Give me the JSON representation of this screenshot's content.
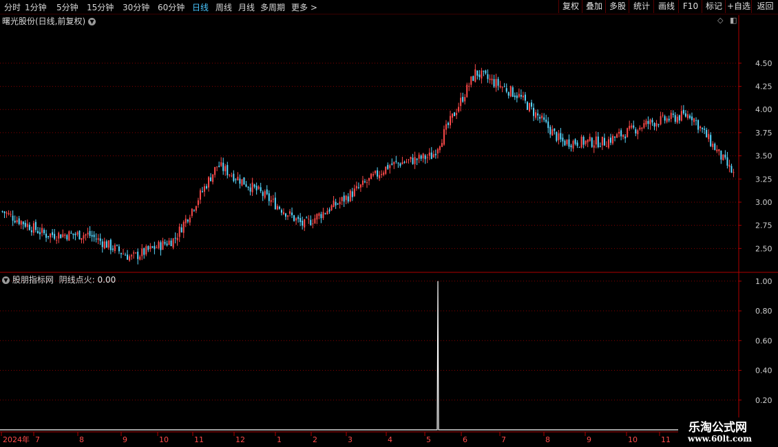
{
  "toolbar": {
    "periods": [
      "分时",
      "1分钟",
      "5分钟",
      "15分钟",
      "30分钟",
      "60分钟",
      "日线",
      "周线",
      "月线",
      "多周期",
      "更多 >"
    ],
    "active_period": "日线",
    "buttons": [
      "复权",
      "叠加",
      "多股",
      "统计",
      "画线",
      "F10",
      "标记",
      "+自选",
      "返回"
    ]
  },
  "main_panel": {
    "title": "曙光股份(日线,前复权)",
    "icons": [
      "diamond-icon",
      "panel-toggle-icon"
    ]
  },
  "indicator_panel": {
    "title": "股朋指标网",
    "series_label": "阴线点火:",
    "series_value": "0.00"
  },
  "watermark": {
    "site_name": "乐淘公式网",
    "url": "www.60lt.com"
  },
  "colors": {
    "up": "#ff4a4a",
    "down": "#58d8ff",
    "background": "#000000",
    "grid": "#8b0000",
    "axis": "#b00000",
    "indicator_line": "#ffffff",
    "active_period": "#49c6ff"
  },
  "chart_data": [
    {
      "type": "candlestick",
      "title": "曙光股份(日线,前复权)",
      "y_ticks": [
        2.5,
        2.75,
        3.0,
        3.25,
        3.5,
        3.75,
        4.0,
        4.25,
        4.5
      ],
      "ylim": [
        2.25,
        4.9
      ],
      "x_axis_labels": [
        "2024年",
        "7",
        "8",
        "9",
        "10",
        "11",
        "12",
        "1",
        "2",
        "3",
        "4",
        "5",
        "6",
        "7",
        "8",
        "9",
        "10",
        "11"
      ],
      "approx_close_path": [
        {
          "month": "2024-06",
          "close": 2.9
        },
        {
          "month": "2024-07",
          "close": 2.65
        },
        {
          "month": "2024-08",
          "close": 2.65
        },
        {
          "month": "2024-09",
          "close": 2.4
        },
        {
          "month": "2024-10",
          "close": 2.6
        },
        {
          "month": "2024-11",
          "close": 3.4
        },
        {
          "month": "2024-12",
          "close": 3.1
        },
        {
          "month": "2025-01",
          "close": 2.75
        },
        {
          "month": "2025-02",
          "close": 3.05
        },
        {
          "month": "2025-03",
          "close": 3.4
        },
        {
          "month": "2025-04",
          "close": 3.5
        },
        {
          "month": "2025-05",
          "close": 4.4
        },
        {
          "month": "2025-06",
          "close": 4.15
        },
        {
          "month": "2025-07",
          "close": 3.65
        },
        {
          "month": "2025-08",
          "close": 3.65
        },
        {
          "month": "2025-09",
          "close": 3.85
        },
        {
          "month": "2025-10",
          "close": 3.95
        },
        {
          "month": "2025-11",
          "close": 3.3
        }
      ],
      "grid": true
    },
    {
      "type": "line",
      "series": [
        {
          "name": "阴线点火",
          "values": [
            0,
            1,
            0
          ]
        }
      ],
      "x": [
        "",
        "2025-05",
        ""
      ],
      "y_ticks": [
        0.2,
        0.4,
        0.6,
        0.8,
        1.0
      ],
      "ylim": [
        0,
        1.05
      ],
      "grid": true
    }
  ]
}
